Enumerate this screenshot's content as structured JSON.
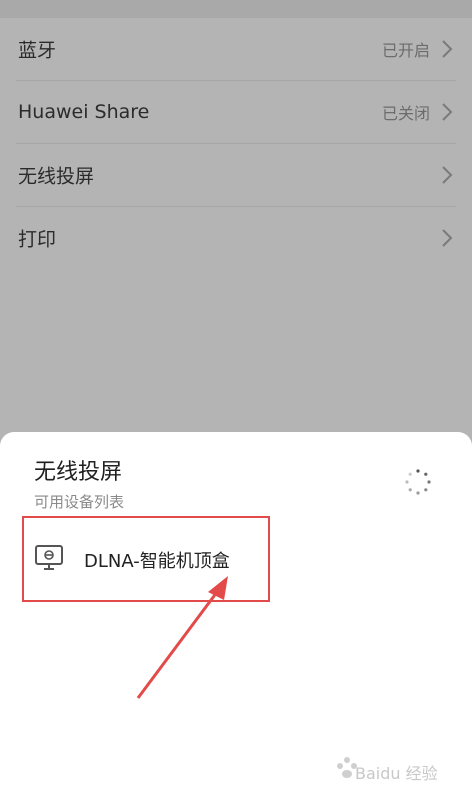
{
  "settings": {
    "items": [
      {
        "label": "蓝牙",
        "status": "已开启"
      },
      {
        "label": "Huawei Share",
        "status": "已关闭"
      },
      {
        "label": "无线投屏",
        "status": ""
      },
      {
        "label": "打印",
        "status": ""
      }
    ]
  },
  "sheet": {
    "title": "无线投屏",
    "subtitle": "可用设备列表",
    "devices": [
      {
        "name": "DLNA-智能机顶盒"
      }
    ]
  },
  "watermark": {
    "text": "Baidu 经验"
  },
  "colors": {
    "overlay": "#b4b4b4",
    "highlight": "#e34a4a",
    "sheet_bg": "#ffffff"
  }
}
